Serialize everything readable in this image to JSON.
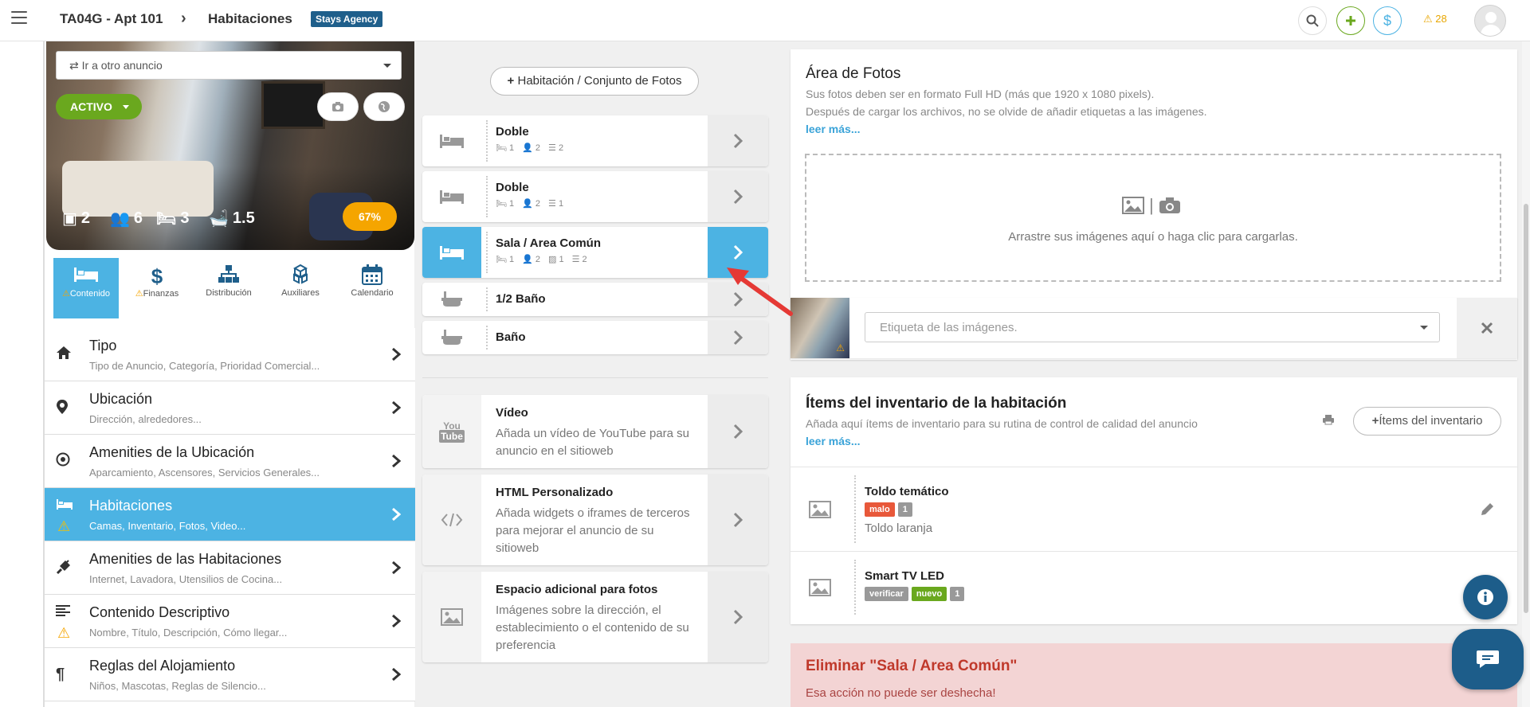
{
  "header": {
    "listing": "TA04G - Apt 101",
    "section": "Habitaciones",
    "agency": "Stays Agency",
    "warning_count": "28"
  },
  "listing_card": {
    "goto_placeholder": "Ir a otro anuncio",
    "status": "ACTIVO",
    "stats": [
      "2",
      "6",
      "3",
      "1.5"
    ],
    "completion": "67%"
  },
  "module_tabs": [
    {
      "label": "Contenido",
      "icon": "bed-icon",
      "active": true,
      "warning": true
    },
    {
      "label": "Finanzas",
      "icon": "dollar-icon",
      "warning": true
    },
    {
      "label": "Distribución",
      "icon": "sitemap-icon"
    },
    {
      "label": "Auxiliares",
      "icon": "cubes-icon"
    },
    {
      "label": "Calendario",
      "icon": "calendar-icon"
    }
  ],
  "menu": [
    {
      "title": "Tipo",
      "subtitle": "Tipo de Anuncio, Categoría, Prioridad Comercial...",
      "icon": "home-icon"
    },
    {
      "title": "Ubicación",
      "subtitle": "Dirección, alrededores...",
      "icon": "map-pin-icon"
    },
    {
      "title": "Amenities de la Ubicación",
      "subtitle": "Aparcamiento, Ascensores, Servicios Generales...",
      "icon": "target-icon"
    },
    {
      "title": "Habitaciones",
      "subtitle": "Camas, Inventario, Fotos, Video...",
      "icon": "bed-icon",
      "active": true
    },
    {
      "title": "Amenities de las Habitaciones",
      "subtitle": "Internet, Lavadora, Utensilios de Cocina...",
      "icon": "plug-icon"
    },
    {
      "title": "Contenido Descriptivo",
      "subtitle": "Nombre, Título, Descripción, Cómo llegar...",
      "icon": "text-lines-icon"
    },
    {
      "title": "Reglas del Alojamiento",
      "subtitle": "Niños, Mascotas, Reglas de Silencio...",
      "icon": "paragraph-icon"
    }
  ],
  "rooms": {
    "add_label": "Habitación / Conjunto de Fotos",
    "items": [
      {
        "name": "Doble",
        "meta": [
          "1",
          "2",
          "2"
        ]
      },
      {
        "name": "Doble",
        "meta": [
          "1",
          "2",
          "1"
        ]
      },
      {
        "name": "Sala / Area Común",
        "meta": [
          "1",
          "2",
          "1",
          "2"
        ],
        "active": true
      },
      {
        "name": "1/2 Baño",
        "meta": []
      },
      {
        "name": "Baño",
        "meta": []
      }
    ]
  },
  "extras": [
    {
      "title": "Vídeo",
      "desc": "Añada un vídeo de YouTube para su anuncio en el sitioweb",
      "icon": "youtube-icon"
    },
    {
      "title": "HTML Personalizado",
      "desc": "Añada widgets o iframes de terceros para mejorar el anuncio de su sitioweb",
      "icon": "code-icon"
    },
    {
      "title": "Espacio adicional para fotos",
      "desc": "Imágenes sobre la dirección, el establecimiento o el contenido de su preferencia",
      "icon": "image-icon"
    }
  ],
  "photos": {
    "title": "Área de Fotos",
    "line1": "Sus fotos deben ser en formato Full HD (más que 1920 x 1080 pixels).",
    "line2": "Después de cargar los archivos, no se olvide de añadir etiquetas a las imágenes.",
    "more": "leer más...",
    "dropzone": "Arrastre sus imágenes aquí o haga clic para cargarlas.",
    "tag_placeholder": "Etiqueta de las imágenes."
  },
  "inventory": {
    "title": "Ítems del inventario de la habitación",
    "desc": "Añada aquí ítems de inventario para su rutina de control de calidad del anuncio",
    "more": "leer más...",
    "add_label": "Ítems del inventario",
    "items": [
      {
        "name": "Toldo temático",
        "badges": [
          {
            "text": "malo",
            "color": "#e8583a"
          },
          {
            "text": "1",
            "color": "#999999"
          }
        ],
        "desc": "Toldo laranja"
      },
      {
        "name": "Smart TV LED",
        "badges": [
          {
            "text": "verificar",
            "color": "#999999"
          },
          {
            "text": "nuevo",
            "color": "#6aa81e"
          },
          {
            "text": "1",
            "color": "#999999"
          }
        ],
        "desc": ""
      }
    ]
  },
  "delete": {
    "title": "Eliminar \"Sala / Area Común\"",
    "text": "Esa acción no puede ser deshecha!"
  },
  "colors": {
    "accent": "#4cb3e3",
    "active_status": "#6aa81e",
    "warning": "#f5a500",
    "danger": "#c0392b"
  }
}
